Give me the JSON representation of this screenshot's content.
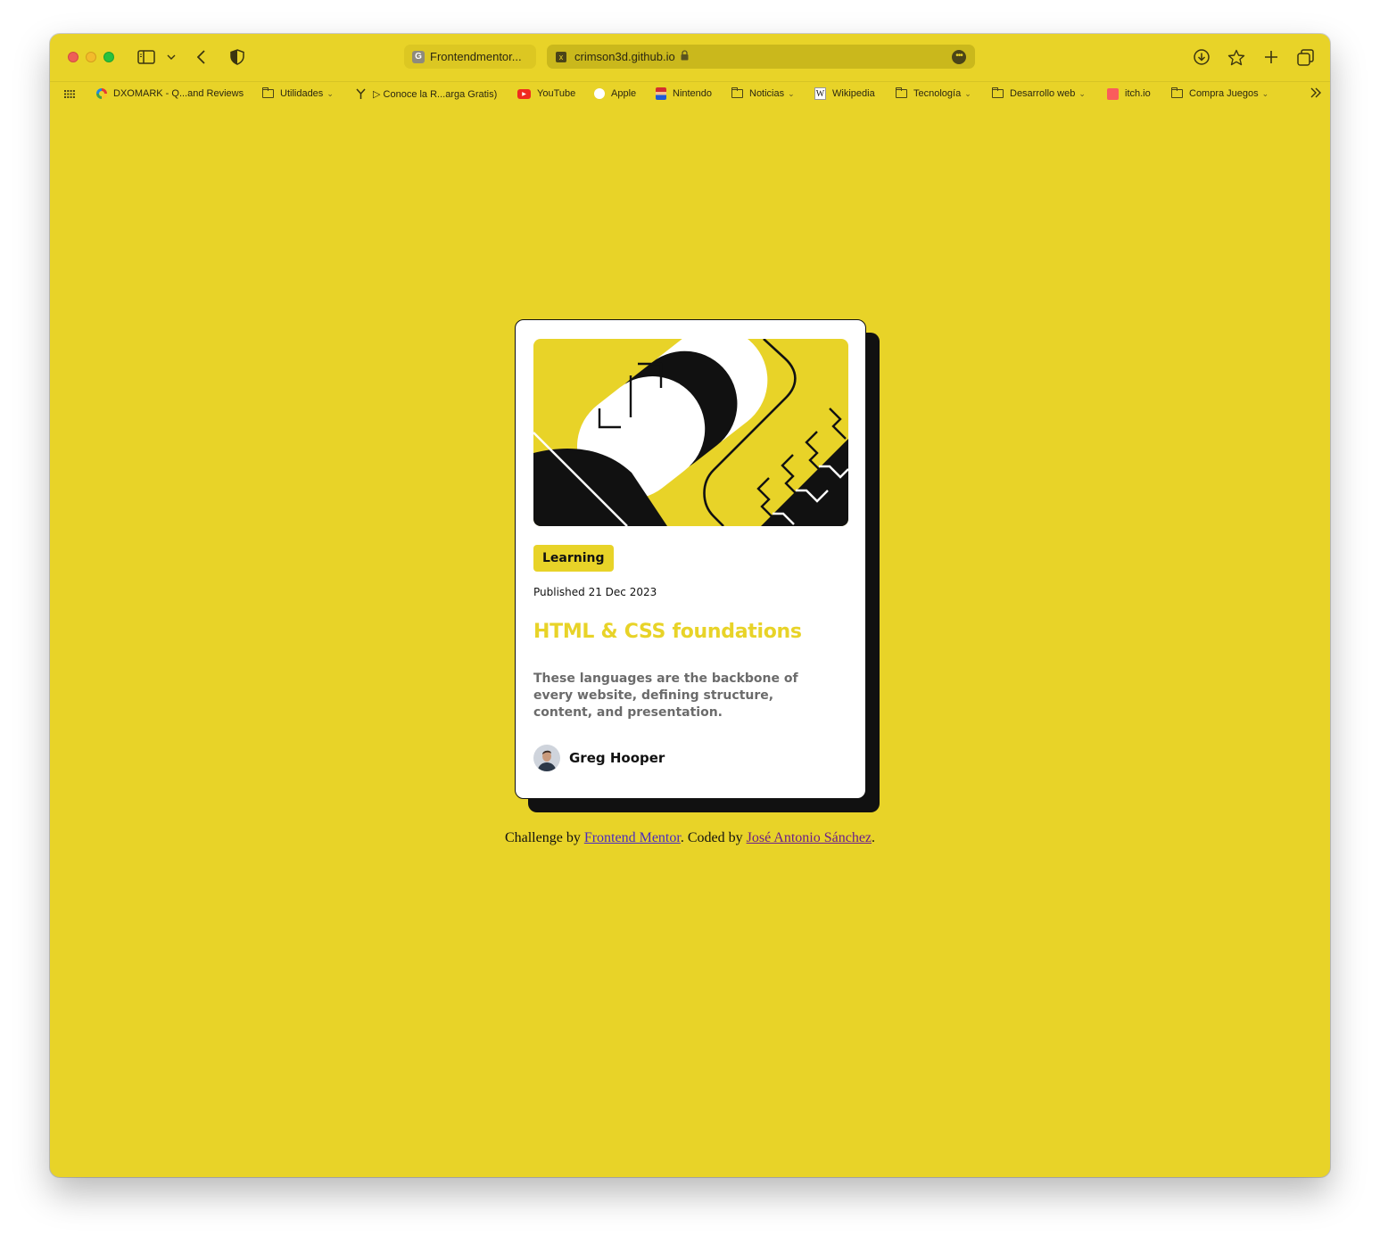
{
  "browser": {
    "tabs": [
      {
        "label": "Frontendmentor...",
        "favicon": "G"
      },
      {
        "label": "crimson3d.github.io",
        "favicon": "x",
        "active": true
      }
    ],
    "icons": {
      "sidebar": "sidebar-icon",
      "back": "back-arrow-icon",
      "privacy": "shield-icon",
      "download": "download-icon",
      "bookmark": "star-icon",
      "new_tab": "plus-icon",
      "tab_overview": "tabs-icon"
    }
  },
  "bookmarks": [
    {
      "label": "DXOMARK - Q...and Reviews",
      "icon": "dxomark-icon"
    },
    {
      "label": "Utilidades",
      "icon": "folder-icon",
      "folder": true
    },
    {
      "label": "▷ Conoce la R...arga Gratis)",
      "icon": "link-icon"
    },
    {
      "label": "YouTube",
      "icon": "youtube-icon"
    },
    {
      "label": "Apple",
      "icon": "apple-icon"
    },
    {
      "label": "Nintendo",
      "icon": "mario-icon"
    },
    {
      "label": "Noticias",
      "icon": "folder-icon",
      "folder": true
    },
    {
      "label": "Wikipedia",
      "icon": "wikipedia-icon"
    },
    {
      "label": "Tecnología",
      "icon": "folder-icon",
      "folder": true
    },
    {
      "label": "Desarrollo web",
      "icon": "folder-icon",
      "folder": true
    },
    {
      "label": "itch.io",
      "icon": "itch-icon"
    },
    {
      "label": "Compra Juegos",
      "icon": "folder-icon",
      "folder": true
    }
  ],
  "card": {
    "badge": "Learning",
    "published": "Published 21 Dec 2023",
    "title": "HTML & CSS foundations",
    "description": "These languages are the backbone of every website, defining structure, content, and presentation.",
    "author": "Greg Hooper"
  },
  "footer": {
    "prefix": "Challenge by ",
    "link1": "Frontend Mentor",
    "middle": ". Coded by ",
    "link2": "José Antonio Sánchez",
    "suffix": "."
  },
  "colors": {
    "background": "#e8d328",
    "card": "#ffffff",
    "ink": "#111111",
    "accent": "#e8d328",
    "muted_text": "#6b6b6b"
  }
}
